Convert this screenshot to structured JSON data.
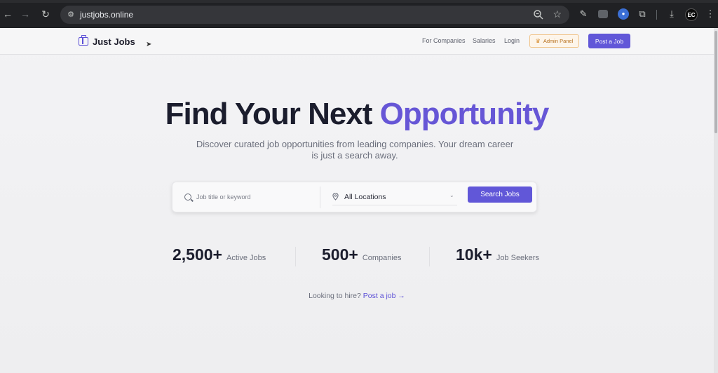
{
  "browser": {
    "url": "justjobs.online",
    "profile_initials": "EC"
  },
  "header": {
    "brand": "Just Jobs",
    "nav": [
      "For Companies",
      "Salaries",
      "Login"
    ],
    "admin_label": "Admin Panel",
    "post_label": "Post a Job"
  },
  "hero": {
    "title_main": "Find Your Next",
    "title_accent": "Opportunity",
    "subtitle": "Discover curated job opportunities from leading companies. Your dream career is just a search away."
  },
  "search": {
    "keyword_placeholder": "Job title or keyword",
    "location_value": "All Locations",
    "button_label": "Search Jobs"
  },
  "stats": [
    {
      "value": "2,500+",
      "label": "Active Jobs"
    },
    {
      "value": "500+",
      "label": "Companies"
    },
    {
      "value": "10k+",
      "label": "Job Seekers"
    }
  ],
  "hire": {
    "prompt": "Looking to hire?",
    "link": "Post a job →"
  },
  "colors": {
    "accent": "#6157d8",
    "title_accent": "#6656d6",
    "admin": "#b7701d"
  }
}
